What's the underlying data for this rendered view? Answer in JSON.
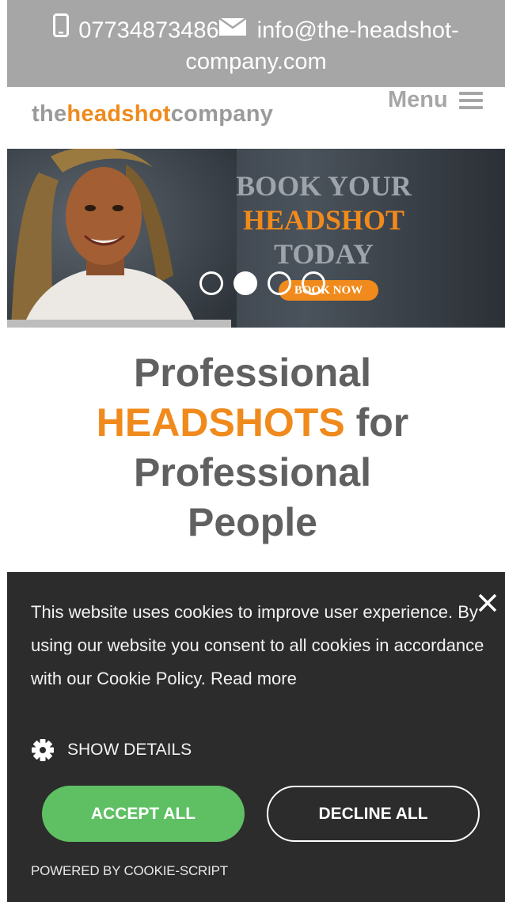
{
  "topbar": {
    "phone": "07734873486",
    "email": "info@the-headshot-company.com",
    "email_line1": "info@the-headshot-",
    "email_line2": "company.com",
    "icons": [
      "phone-icon",
      "mail-icon"
    ]
  },
  "header": {
    "logo_the": "the",
    "logo_headshot": "headshot",
    "logo_company": "company",
    "menu_label": "Menu",
    "menu_icon": "hamburger-icon"
  },
  "hero": {
    "line1": "BOOK YOUR",
    "line2": "HEADSHOT",
    "line3": "TODAY",
    "button": "BOOK NOW",
    "slides": 4,
    "active_slide": 2
  },
  "intro": {
    "line1": "Professional",
    "accent": "HEADSHOTS",
    "line2_rest": " for",
    "line3": "Professional",
    "line4": "People"
  },
  "cookie": {
    "message": "This website uses cookies to improve user experience. By using our website you consent to all cookies in accordance with our Cookie Policy. Read more",
    "show_details": "SHOW DETAILS",
    "accept": "ACCEPT ALL",
    "decline": "DECLINE ALL",
    "powered": "POWERED BY COOKIE-SCRIPT",
    "icons": [
      "close-icon",
      "gear-icon"
    ]
  },
  "colors": {
    "accent": "#f08a1c",
    "topbar_bg": "#a6a6a6",
    "cookie_bg": "#2c2c2c",
    "accept_green": "#5fbf63",
    "text_gray": "#606060"
  }
}
